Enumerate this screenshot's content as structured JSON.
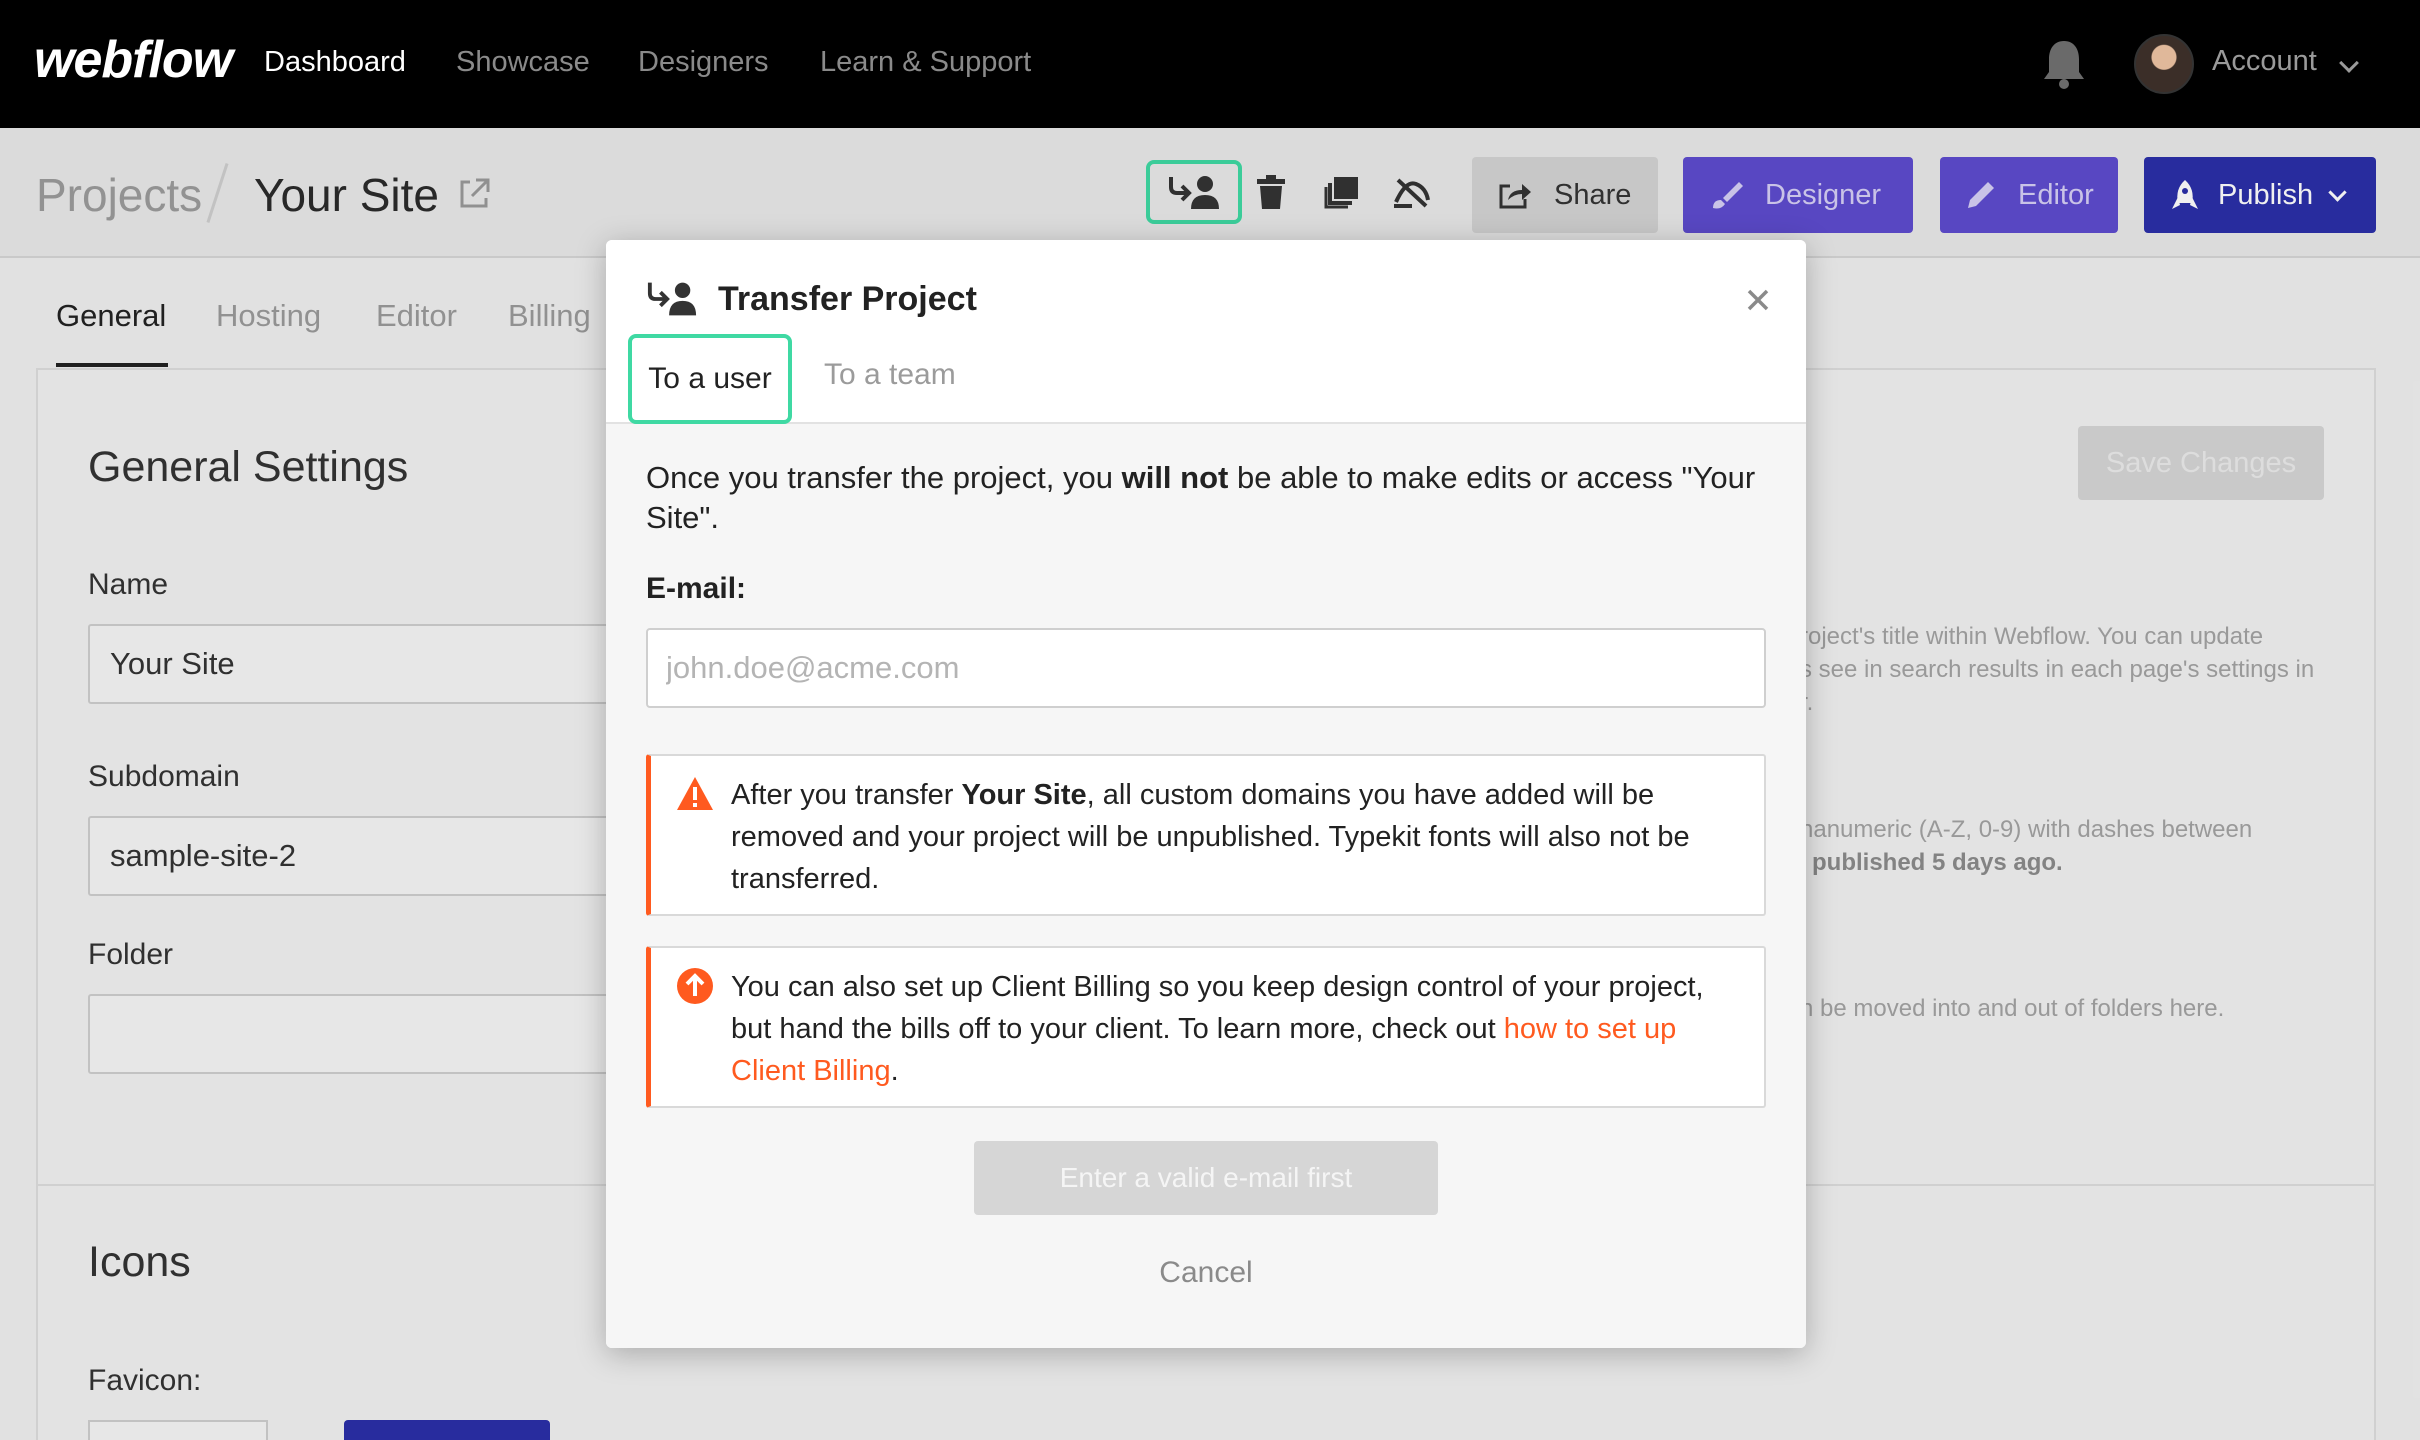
{
  "nav": {
    "logo": "webflow",
    "links": [
      "Dashboard",
      "Showcase",
      "Designers",
      "Learn & Support"
    ],
    "account_label": "Account"
  },
  "project_bar": {
    "breadcrumb_root": "Projects",
    "site_name": "Your Site",
    "buttons": {
      "share": "Share",
      "designer": "Designer",
      "editor": "Editor",
      "publish": "Publish"
    }
  },
  "page": {
    "tabs": [
      "General",
      "Hosting",
      "Editor",
      "Billing"
    ],
    "heading": "General Settings",
    "save_button": "Save Changes",
    "fields": {
      "name_label": "Name",
      "name_value": "Your Site",
      "subdomain_label": "Subdomain",
      "subdomain_value": "sample-site-2",
      "folder_label": "Folder",
      "folder_value": ""
    },
    "help": {
      "name_help": "roject's title within Webflow. You can update\ns see in search results in each page's settings in\nr.",
      "subdomain_help": "hanumeric (A-Z, 0-9) with dashes between",
      "subdomain_published": "published 5 days ago.",
      "folder_help": "n be moved into and out of folders here."
    },
    "icons_heading": "Icons",
    "favicon_label": "Favicon:"
  },
  "modal": {
    "title": "Transfer Project",
    "tabs": [
      "To a user",
      "To a team"
    ],
    "intro_before": "Once you transfer the project, you ",
    "intro_bold": "will not",
    "intro_after": " be able to make edits or access \"Your Site\".",
    "email_label": "E-mail:",
    "email_placeholder": "john.doe@acme.com",
    "warning_before": "After you transfer ",
    "warning_bold": "Your Site",
    "warning_after": ", all custom domains you have added will be removed and your project will be unpublished. Typekit fonts will also not be transferred.",
    "info_before": "You can also set up Client Billing so you keep design control of your project, but hand the bills off to your client. To learn more, check out ",
    "info_link": "how to set up Client Billing",
    "info_after": ".",
    "submit_button": "Enter a valid e-mail first",
    "cancel_button": "Cancel"
  },
  "colors": {
    "highlight": "#3fd9a3",
    "designer_purple": "#5e4ccf",
    "publish_blue": "#2b2fa8",
    "alert_orange": "#ff5a1f"
  }
}
